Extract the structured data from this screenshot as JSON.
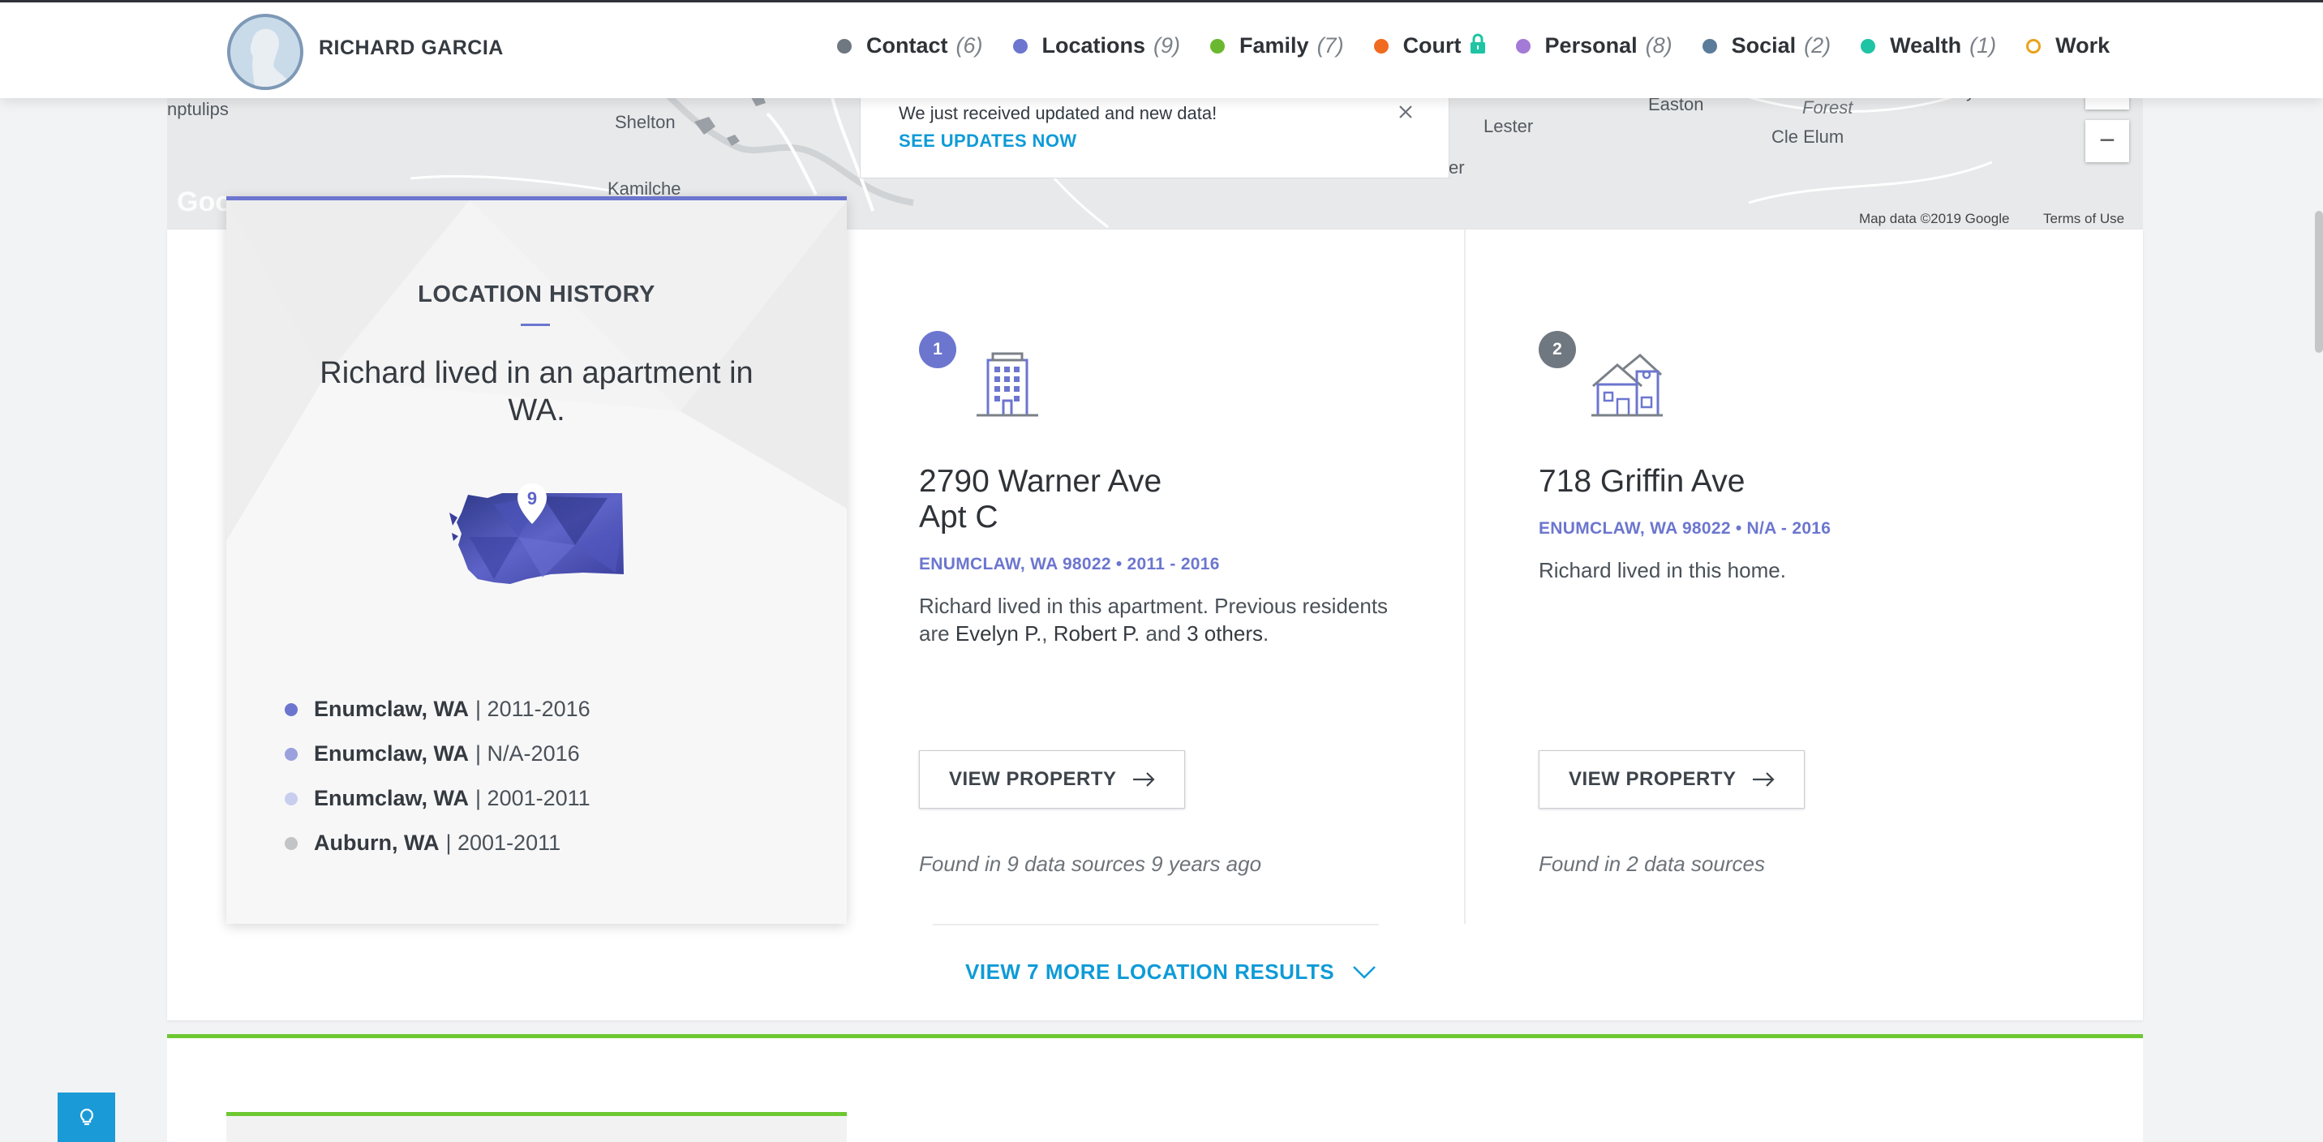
{
  "header": {
    "person_name": "RICHARD GARCIA",
    "nav": [
      {
        "label": "Contact",
        "count": "(6)",
        "color": "#6f7780"
      },
      {
        "label": "Locations",
        "count": "(9)",
        "color": "#6c76cf"
      },
      {
        "label": "Family",
        "count": "(7)",
        "color": "#6ab830"
      },
      {
        "label": "Court",
        "count": "",
        "color": "#f06a1f",
        "icon": "lock-icon"
      },
      {
        "label": "Personal",
        "count": "(8)",
        "color": "#a37ad6"
      },
      {
        "label": "Social",
        "count": "(2)",
        "color": "#5a7c9a"
      },
      {
        "label": "Wealth",
        "count": "(1)",
        "color": "#1fc4a4"
      },
      {
        "label": "Work",
        "count": "",
        "color": "#e8a31b"
      }
    ]
  },
  "map": {
    "places": [
      "nptulips",
      "Shelton",
      "Kamilche",
      "Lester",
      "Easton",
      "Forest",
      "Cle Elum",
      "Liberty",
      "er"
    ],
    "zoom_in": "+",
    "zoom_out": "−",
    "credit": "Map data ©2019 Google",
    "terms": "Terms of Use",
    "google_mark": "Goo"
  },
  "notification": {
    "message": "We just received updated and new data!",
    "link": "SEE UPDATES NOW"
  },
  "history": {
    "title": "LOCATION HISTORY",
    "summary": "Richard lived in an apartment in WA.",
    "map_count": "9",
    "items": [
      {
        "place": "Enumclaw, WA",
        "years": "| 2011-2016",
        "color": "#6c76cf"
      },
      {
        "place": "Enumclaw, WA",
        "years": "| N/A-2016",
        "color": "#9aa1dd"
      },
      {
        "place": "Enumclaw, WA",
        "years": "| 2001-2011",
        "color": "#c9cdee"
      },
      {
        "place": "Auburn, WA",
        "years": "| 2001-2011",
        "color": "#c2c4c6"
      }
    ]
  },
  "properties": [
    {
      "badge": "1",
      "badge_color": "#6c76cf",
      "icon": "apartment-building-icon",
      "street_line1": "2790 Warner Ave",
      "street_line2": "Apt C",
      "city": "ENUMCLAW, WA 98022",
      "sep": "•",
      "years": "2011 - 2016",
      "desc_prefix": "Richard lived in this apartment. Previous residents are ",
      "resident1": "Evelyn P.",
      "comma": ", ",
      "resident2": "Robert P.",
      "and": " and ",
      "others": "3 others",
      "period": ".",
      "button": "VIEW PROPERTY",
      "found": "Found in 9 data sources 9 years ago"
    },
    {
      "badge": "2",
      "badge_color": "#6f7780",
      "icon": "house-icon",
      "street_line1": "718 Griffin Ave",
      "city": "ENUMCLAW, WA 98022",
      "sep": "•",
      "years": "N/A - 2016",
      "desc": "Richard lived in this home.",
      "button": "VIEW PROPERTY",
      "found": "Found in 2 data sources"
    }
  ],
  "more_results": "VIEW 7 MORE LOCATION RESULTS"
}
